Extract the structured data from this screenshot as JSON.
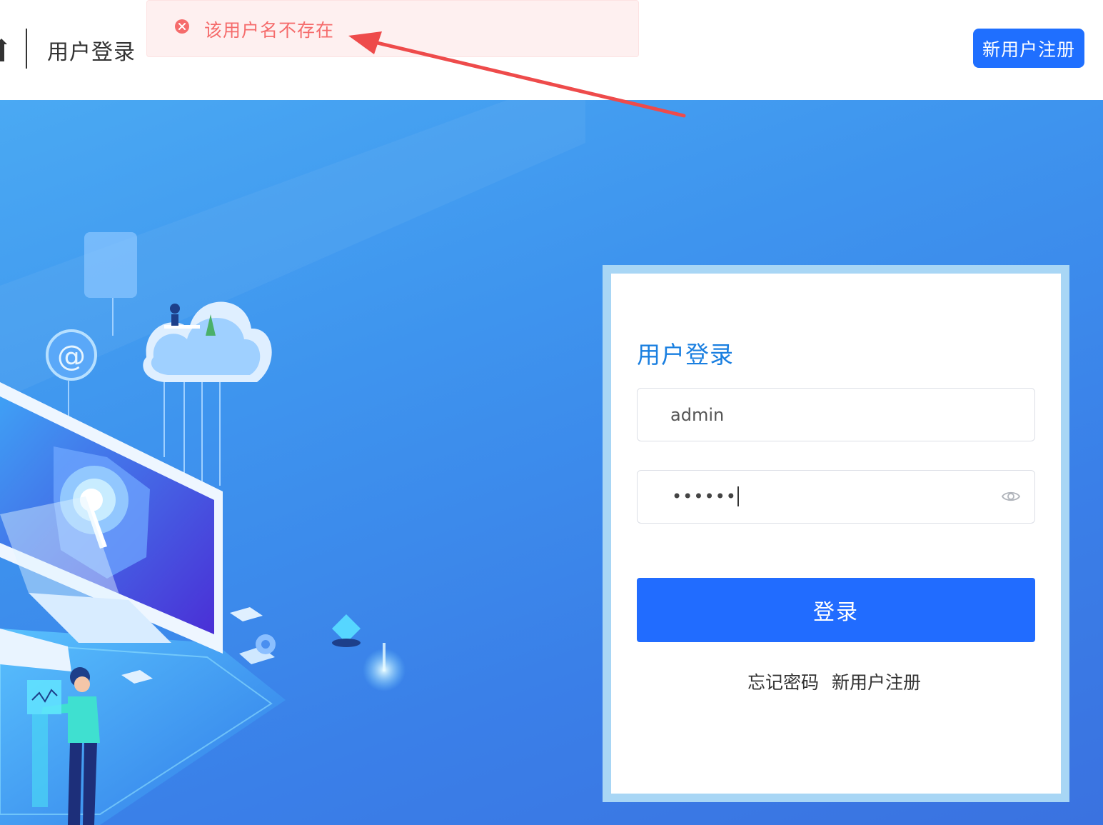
{
  "header": {
    "title": "用户登录",
    "register_button": "新用户注册"
  },
  "toast": {
    "type": "error",
    "message": "该用户名不存在"
  },
  "login": {
    "title": "用户登录",
    "username_value": "admin",
    "password_mask": "••••••",
    "submit_label": "登录",
    "forgot_link": "忘记密码",
    "register_link": "新用户注册"
  },
  "colors": {
    "primary": "#216cff",
    "title_blue": "#1a7fe0",
    "error": "#f56c6c",
    "error_bg": "#fef0f0",
    "annotation_arrow": "#ee4b4b"
  },
  "icons": {
    "toast": "close-circle-icon",
    "password_toggle": "eye-icon"
  }
}
